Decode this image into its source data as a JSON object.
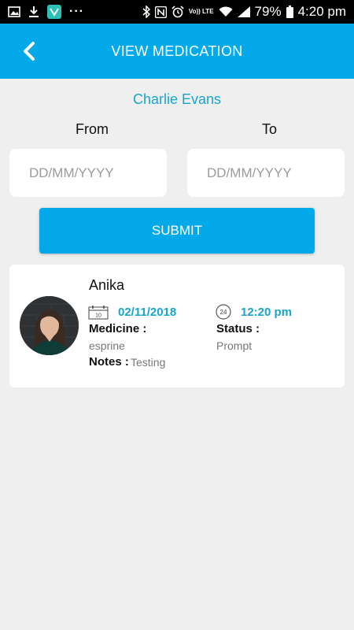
{
  "status_bar": {
    "battery_percent": "79%",
    "time": "4:20 pm",
    "left_icons": [
      "image-icon",
      "download-icon",
      "app-notification-icon",
      "more-dots-icon"
    ],
    "right_icons": [
      "bluetooth-icon",
      "nfc-icon",
      "alarm-icon",
      "volte-icon",
      "wifi-icon",
      "signal-icon",
      "battery-icon"
    ],
    "volte_text": "Vo)) LTE"
  },
  "header": {
    "title": "VIEW MEDICATION",
    "back_icon": "chevron-left-icon"
  },
  "colors": {
    "primary": "#03a9e8",
    "accent_text": "#17a6c9",
    "background": "#efefef"
  },
  "patient": {
    "name": "Charlie Evans"
  },
  "filters": {
    "from_label": "From",
    "to_label": "To",
    "from_placeholder": "DD/MM/YYYY",
    "to_placeholder": "DD/MM/YYYY",
    "submit_label": "SUBMIT"
  },
  "records": [
    {
      "name": "Anika",
      "date": "02/11/2018",
      "time": "12:20 pm",
      "medicine_label": "Medicine :",
      "medicine": "esprine",
      "status_label": "Status :",
      "status": "Prompt",
      "notes_label": "Notes :",
      "notes": "Testing",
      "calendar_icon_text": "10",
      "clock_icon_text": "24"
    }
  ]
}
